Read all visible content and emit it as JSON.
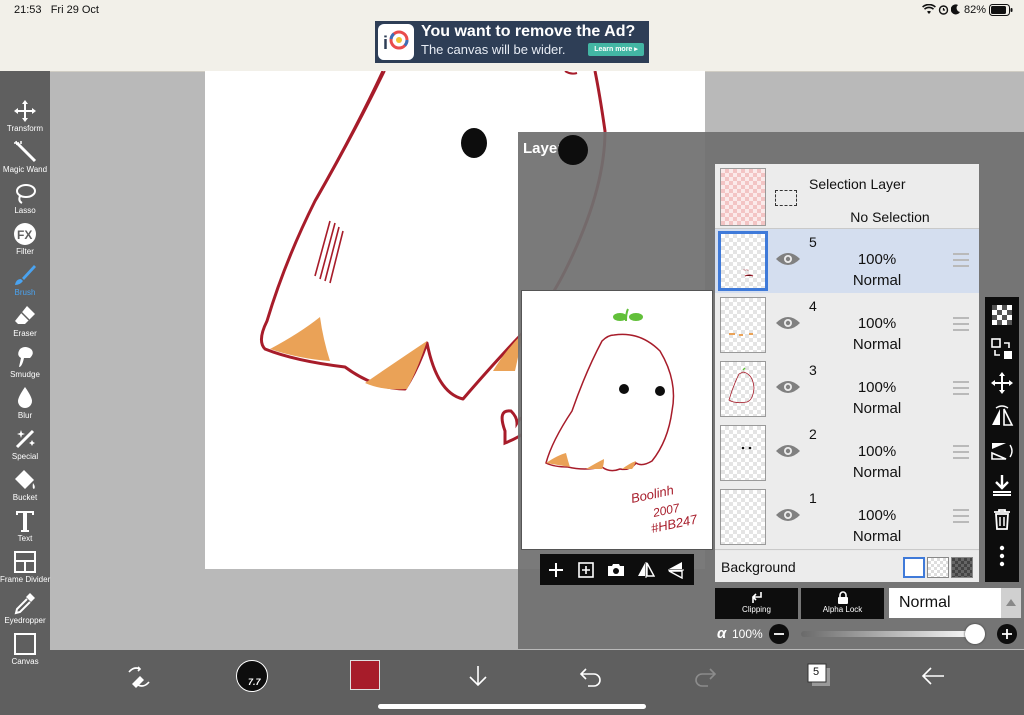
{
  "status_bar": {
    "time": "21:53",
    "date": "Fri 29 Oct",
    "battery_percent": "82%"
  },
  "ad": {
    "title": "You want to remove the Ad?",
    "subtitle": "The canvas will be wider.",
    "cta": "Learn more ▸"
  },
  "tools": [
    {
      "label": "Transform",
      "icon": "move-icon"
    },
    {
      "label": "Magic Wand",
      "icon": "magic-wand-icon"
    },
    {
      "label": "Lasso",
      "icon": "lasso-icon"
    },
    {
      "label": "Filter",
      "icon": "fx-icon"
    },
    {
      "label": "Brush",
      "icon": "brush-icon",
      "active": true
    },
    {
      "label": "Eraser",
      "icon": "eraser-icon"
    },
    {
      "label": "Smudge",
      "icon": "smudge-icon"
    },
    {
      "label": "Blur",
      "icon": "blur-drop-icon"
    },
    {
      "label": "Special",
      "icon": "special-wand-icon"
    },
    {
      "label": "Bucket",
      "icon": "bucket-icon"
    },
    {
      "label": "Text",
      "icon": "text-icon"
    },
    {
      "label": "Frame Divider",
      "icon": "frame-divider-icon"
    },
    {
      "label": "Eyedropper",
      "icon": "eyedropper-icon"
    },
    {
      "label": "Canvas",
      "icon": "canvas-icon"
    }
  ],
  "layer_panel": {
    "title": "Layer",
    "selection_layer": {
      "name": "Selection Layer",
      "status": "No Selection"
    },
    "layers": [
      {
        "number": "5",
        "opacity": "100%",
        "blend": "Normal",
        "selected": true
      },
      {
        "number": "4",
        "opacity": "100%",
        "blend": "Normal",
        "selected": false
      },
      {
        "number": "3",
        "opacity": "100%",
        "blend": "Normal",
        "selected": false
      },
      {
        "number": "2",
        "opacity": "100%",
        "blend": "Normal",
        "selected": false
      },
      {
        "number": "1",
        "opacity": "100%",
        "blend": "Normal",
        "selected": false
      }
    ],
    "background_label": "Background",
    "clipping_label": "Clipping",
    "alpha_lock_label": "Alpha Lock",
    "alpha_glyph": "α",
    "blend_mode": "Normal",
    "alpha_value": "100%",
    "alpha_fraction": 1.0
  },
  "artwork": {
    "signature_line1": "Boolinh",
    "signature_line2": "2007",
    "signature_line3": "#HB247"
  },
  "bottom_bar": {
    "brush_size": "7.7",
    "layer_count": "5",
    "color": "#a71c2a"
  },
  "colors": {
    "accent": "#3f7ad9",
    "ink": "#a71c2a",
    "fill_orange": "#eaa257",
    "sprout_green": "#62c03a"
  }
}
